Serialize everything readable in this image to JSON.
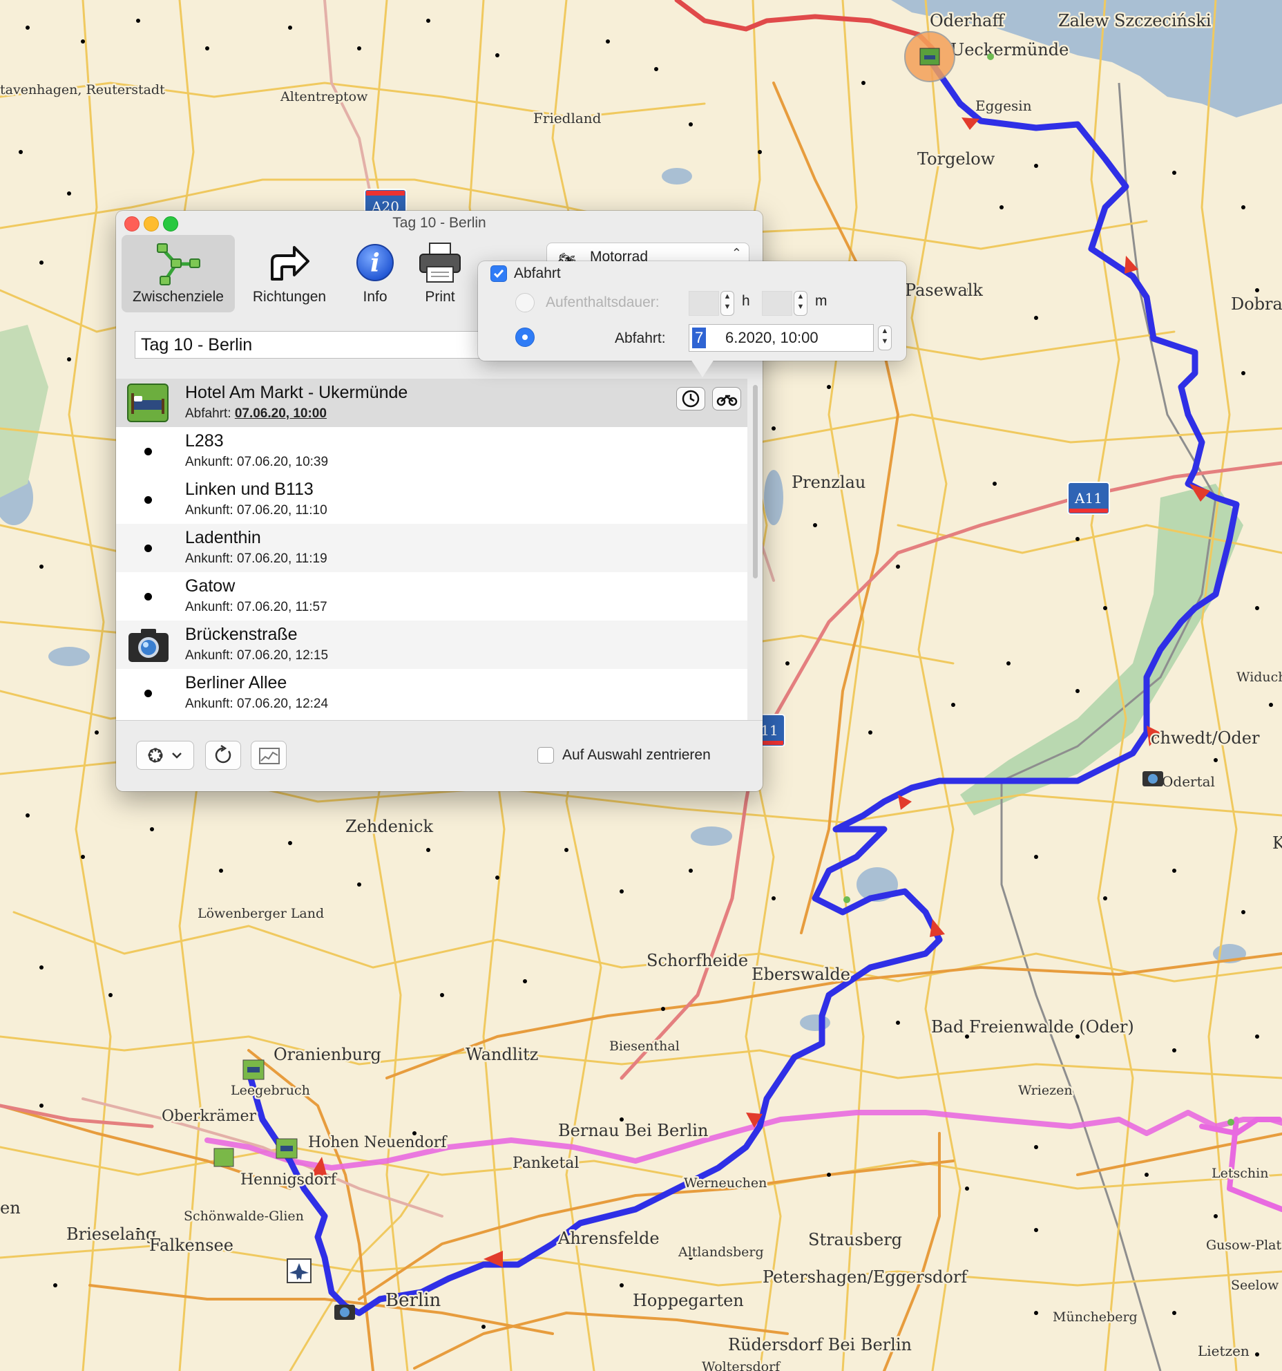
{
  "window": {
    "title": "Tag 10 - Berlin",
    "toolbar": [
      {
        "label": "Zwischenziele",
        "icon": "waypoints-icon",
        "active": true
      },
      {
        "label": "Richtungen",
        "icon": "directions-arrow-icon"
      },
      {
        "label": "Info",
        "icon": "info-icon"
      },
      {
        "label": "Print",
        "icon": "printer-icon"
      }
    ],
    "mode_label": "Motorrad",
    "route_name": "Tag 10 - Berlin",
    "waypoints": [
      {
        "name": "Hotel Am Markt - Ukermünde",
        "prefix": "Abfahrt: ",
        "time": "07.06.20, 10:00",
        "icon": "hotel-bed-icon"
      },
      {
        "name": "L283",
        "prefix": "Ankunft: ",
        "time": "07.06.20, 10:39"
      },
      {
        "name": "Linken und  B113",
        "prefix": "Ankunft: ",
        "time": "07.06.20, 11:10"
      },
      {
        "name": "Ladenthin",
        "prefix": "Ankunft: ",
        "time": "07.06.20, 11:19"
      },
      {
        "name": "Gatow",
        "prefix": "Ankunft: ",
        "time": "07.06.20, 11:57"
      },
      {
        "name": "Brückenstraße",
        "prefix": "Ankunft: ",
        "time": "07.06.20, 12:15",
        "icon": "camera-icon"
      },
      {
        "name": "Berliner Allee",
        "prefix": "Ankunft: ",
        "time": "07.06.20, 12:24"
      }
    ],
    "center_checkbox_label": "Auf Auswahl zentrieren",
    "center_checkbox_checked": false
  },
  "popover": {
    "departure_label": "Abfahrt",
    "departure_checked": true,
    "stay_label": "Aufenthaltsdauer:",
    "hours_unit": "h",
    "minutes_unit": "m",
    "departure_field_label": "Abfahrt:",
    "date_day": "7",
    "date_rest": "6.2020, 10:00"
  },
  "map": {
    "cities": [
      "Oderhaff",
      "Zalew Szczeciński",
      "Ueckermünde",
      "tavenhagen, Reuterstadt",
      "Altentreptow",
      "Friedland",
      "Eggesin",
      "Torgelow",
      "Pasewalk",
      "Dobra",
      "Prenzlau",
      "chwedt/Oder",
      "Odertal",
      "Widuch",
      "Zehdenick",
      "Löwenberger Land",
      "Schorfheide",
      "Eberswalde",
      "Bad Freienwalde (Oder)",
      "Oranienburg",
      "Wandlitz",
      "Biesenthal",
      "Wriezen",
      "Leegebruch",
      "Oberkrämer",
      "Hohen Neuendorf",
      "Bernau Bei Berlin",
      "Panketal",
      "Hennigsdorf",
      "Werneuchen",
      "Letschin",
      "Schönwalde-Glien",
      "Brieselang",
      "Falkensee",
      "Ahrensfelde",
      "Altlandsberg",
      "Strausberg",
      "Gusow-Plat",
      "Petershagen/Eggersdorf",
      "Seelow",
      "Berlin",
      "Hoppegarten",
      "Müncheberg",
      "Rüdersdorf Bei Berlin",
      "Lietzen",
      "Woltersdorf",
      "en",
      "K",
      "Berlin"
    ],
    "shields": [
      "A20",
      "A11",
      "11"
    ],
    "route_color": "#2f2fe6",
    "alt_route_color": "#e86ae0"
  }
}
